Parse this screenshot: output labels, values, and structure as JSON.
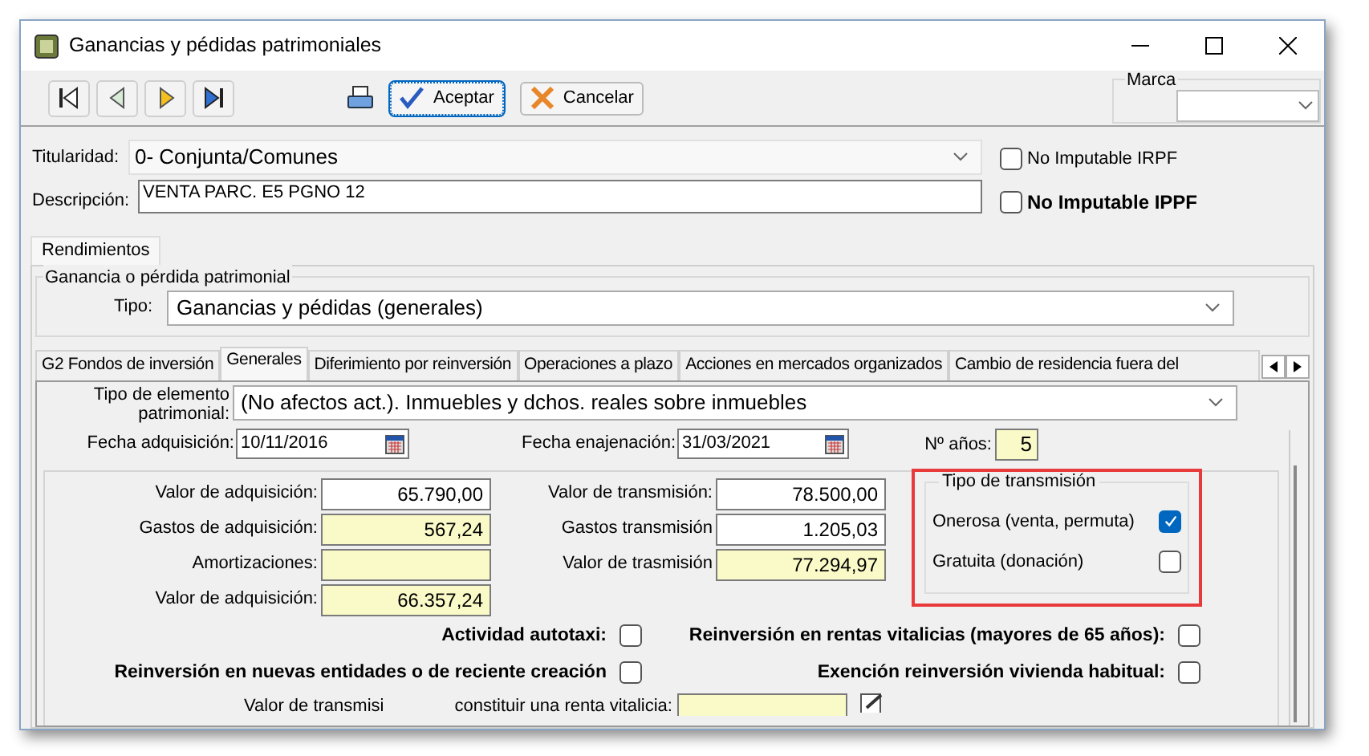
{
  "window": {
    "title": "Ganancias y pédidas patrimoniales"
  },
  "buttons": [
    {
      "label": "Aceptar",
      "kind": "accept",
      "focused": true
    },
    {
      "label": "Cancelar",
      "kind": "cancel",
      "focused": false
    }
  ],
  "marca": {
    "label": "Marca"
  },
  "titularidad": {
    "label": "Titularidad:",
    "value": "0- Conjunta/Comunes"
  },
  "descripcion": {
    "label": "Descripción:",
    "value": "VENTA PARC. E5 PGNO 12"
  },
  "top_checks": [
    {
      "label": "No Imputable IRPF",
      "checked": false,
      "kind": "plain"
    },
    {
      "label": "No Imputable IPPF",
      "checked": false,
      "kind": "strong"
    }
  ],
  "outer_tabs": [
    {
      "label": "Rendimientos",
      "selected": true
    }
  ],
  "group": {
    "title": "Ganancia o pérdida patrimonial",
    "tipo_label": "Tipo:",
    "tipo_value": "Ganancias y pédidas (generales)"
  },
  "tabs": [
    {
      "label": "G2 Fondos de inversión",
      "selected": false
    },
    {
      "label": "Generales",
      "selected": true
    },
    {
      "label": "Diferimiento por reinversión",
      "selected": false
    },
    {
      "label": "Operaciones a plazo",
      "selected": false
    },
    {
      "label": "Acciones en mercados organizados",
      "selected": false
    },
    {
      "label": "Cambio de residencia fuera del",
      "selected": false
    }
  ],
  "generales": {
    "elemento_label": "Tipo de elemento patrimonial:",
    "elemento_value": "(No afectos act.). Inmuebles y dchos. reales sobre inmuebles",
    "fecha_adq_label": "Fecha adquisición:",
    "fecha_adq": "10/11/2016",
    "fecha_enaj_label": "Fecha enajenación:",
    "fecha_enaj": "31/03/2021",
    "anos_label": "Nº años:",
    "anos": "5"
  },
  "left_fields": [
    {
      "label": "Valor de adquisición:",
      "value": "65.790,00",
      "kind": "input"
    },
    {
      "label": "Gastos de adquisición:",
      "value": "567,24",
      "kind": "computed"
    },
    {
      "label": "Amortizaciones:",
      "kind": "computed"
    },
    {
      "label": "Valor de adquisición:",
      "value": "66.357,24",
      "kind": "computed"
    }
  ],
  "right_fields": [
    {
      "label": "Valor de transmisión:",
      "value": "78.500,00",
      "kind": "input"
    },
    {
      "label": "Gastos transmisión",
      "value": "1.205,03",
      "kind": "input"
    },
    {
      "label": "Valor de trasmisión",
      "value": "77.294,97",
      "kind": "computed"
    }
  ],
  "transmision": {
    "title": "Tipo de transmisión",
    "options": [
      {
        "label": "Onerosa (venta, permuta)",
        "checked": true
      },
      {
        "label": "Gratuita (donación)",
        "checked": false
      }
    ]
  },
  "flag_rows": [
    [
      {
        "label": "Actividad autotaxi:",
        "checked": false
      },
      {
        "label": "Reinversión en rentas vitalicias (mayores de 65 años):",
        "checked": false
      }
    ],
    [
      {
        "label": "Reinversión en nuevas entidades o de reciente creación",
        "checked": false
      },
      {
        "label": "Exención reinversión vivienda habitual:",
        "checked": false
      }
    ]
  ],
  "renta_vitalicia": {
    "label_start": "Valor de transmisi",
    "label_end": "constituir una renta vitalicia:"
  }
}
